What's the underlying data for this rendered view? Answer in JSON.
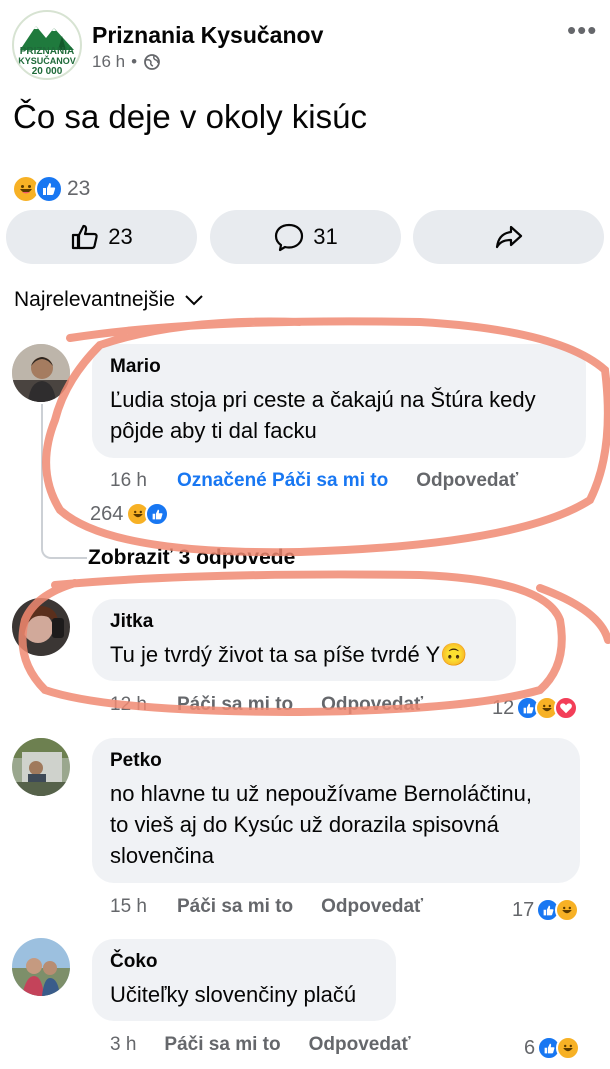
{
  "post": {
    "page_name": "Priznania Kysučanov",
    "time": "16 h",
    "separator": "•",
    "logo": {
      "line1": "PRIZNANIA",
      "line2": "KYSUČANOV",
      "line3": "20 000"
    },
    "text": "Čo sa deje v okoly kisúc",
    "reactions_count": "23",
    "like_count": "23",
    "comment_count": "31",
    "sort_label": "Najrelevantnejšie"
  },
  "comments": [
    {
      "name": "Mario",
      "text": "Ľudia stoja pri ceste a čakajú na Štúra kedy pôjde aby ti dal facku",
      "time": "16 h",
      "like_label": "Označené Páči sa mi to",
      "reply_label": "Odpovedať",
      "reactions": "264",
      "view_replies": "Zobraziť 3 odpovede"
    },
    {
      "name": "Jitka",
      "text": "Tu je tvrdý život ta sa píše tvrdé Y",
      "emoji": "🙃",
      "time": "12 h",
      "like_label": "Páči sa mi to",
      "reply_label": "Odpovedať",
      "reactions": "12"
    },
    {
      "name": "Petko",
      "text_lines": [
        "no hlavne tu už nepoužívame Bernoláčtinu,",
        "to vieš aj do Kysúc už dorazila spisovná",
        "slovenčina"
      ],
      "time": "15 h",
      "like_label": "Páči sa mi to",
      "reply_label": "Odpovedať",
      "reactions": "17"
    },
    {
      "name": "Čoko",
      "text": "Učiteľky slovenčiny plačú",
      "time": "3 h",
      "like_label": "Páči sa mi to",
      "reply_label": "Odpovedať",
      "reactions": "6"
    }
  ],
  "icons": [
    "globe-icon",
    "more-icon",
    "like-icon",
    "comment-icon",
    "share-icon",
    "chevron-down-icon",
    "haha-emoji-icon",
    "like-emoji-icon",
    "love-emoji-icon"
  ],
  "colors": {
    "accent": "#1877f2",
    "haha": "#f7b125",
    "love": "#f33e58",
    "annotation": "#f08a72"
  }
}
